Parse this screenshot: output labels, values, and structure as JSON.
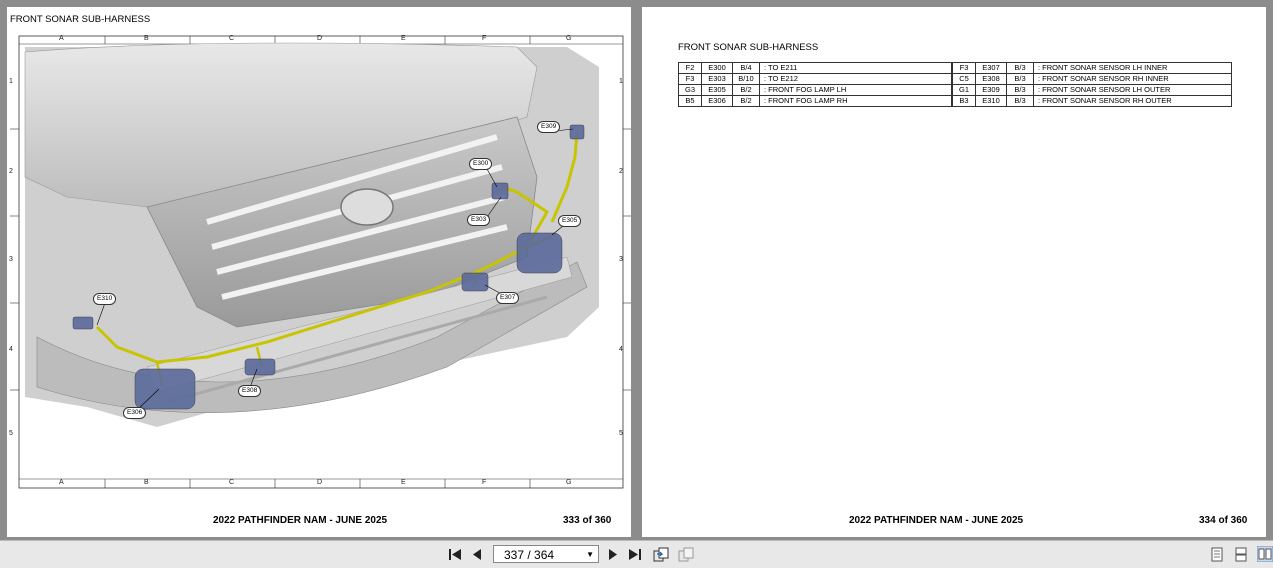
{
  "left_page": {
    "title": "FRONT SONAR SUB-HARNESS",
    "grid_letters": [
      "A",
      "B",
      "C",
      "D",
      "E",
      "F",
      "G"
    ],
    "grid_numbers": [
      "1",
      "2",
      "3",
      "4",
      "5"
    ],
    "callouts": [
      "E309",
      "E300",
      "E303",
      "E305",
      "E307",
      "E310",
      "E308",
      "E306"
    ],
    "footer_doc": "2022 PATHFINDER NAM - JUNE 2025",
    "footer_page": "333 of 360"
  },
  "right_page": {
    "title": "FRONT SONAR SUB-HARNESS",
    "table_left": [
      [
        "F2",
        "E300",
        "B/4",
        ": TO E211"
      ],
      [
        "F3",
        "E303",
        "B/10",
        ": TO E212"
      ],
      [
        "G3",
        "E305",
        "B/2",
        ": FRONT FOG LAMP LH"
      ],
      [
        "B5",
        "E306",
        "B/2",
        ": FRONT FOG LAMP RH"
      ]
    ],
    "table_right": [
      [
        "F3",
        "E307",
        "B/3",
        ": FRONT SONAR SENSOR LH INNER"
      ],
      [
        "C5",
        "E308",
        "B/3",
        ": FRONT SONAR SENSOR RH INNER"
      ],
      [
        "G1",
        "E309",
        "B/3",
        ": FRONT SONAR SENSOR LH OUTER"
      ],
      [
        "B3",
        "E310",
        "B/3",
        ": FRONT SONAR SENSOR RH OUTER"
      ]
    ],
    "footer_doc": "2022 PATHFINDER NAM - JUNE 2025",
    "footer_page": "334 of 360"
  },
  "toolbar": {
    "page_display": "337 / 364"
  }
}
